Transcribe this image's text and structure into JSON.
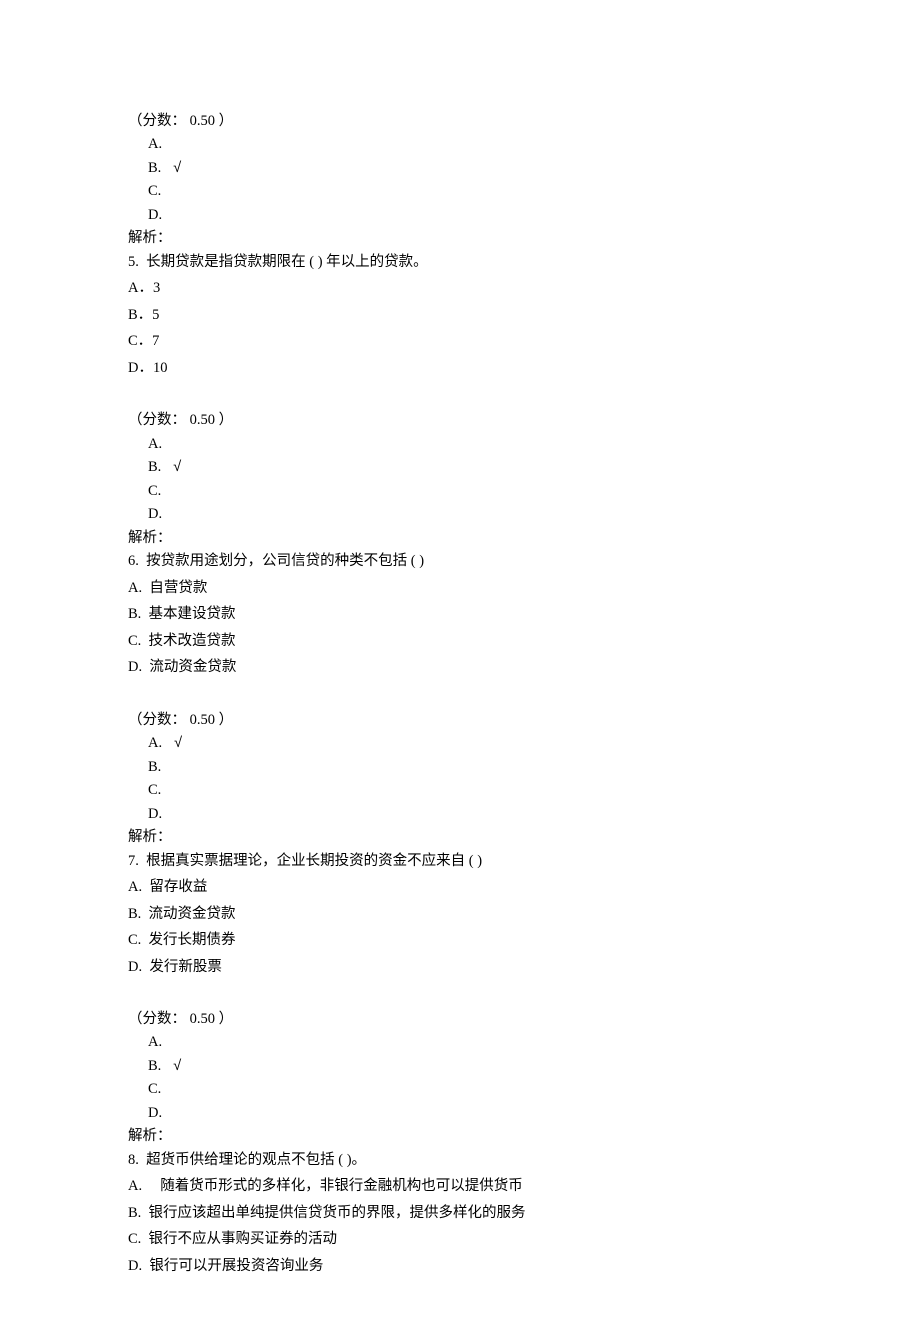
{
  "q4": {
    "score_label": "（分数： 0.50 ）",
    "ansA": "A.",
    "ansB": "B.",
    "ansB_mark": "√",
    "ansC": "C.",
    "ansD": "D.",
    "analysis": "解析："
  },
  "q5": {
    "stem": "5.  长期贷款是指贷款期限在 ( ) 年以上的贷款。",
    "optA": "A．3",
    "optB": "B．5",
    "optC": "C．7",
    "optD": "D．10",
    "score_label": "（分数： 0.50 ）",
    "ansA": "A.",
    "ansB": "B.",
    "ansB_mark": "√",
    "ansC": "C.",
    "ansD": "D.",
    "analysis": "解析："
  },
  "q6": {
    "stem": "6.  按贷款用途划分，公司信贷的种类不包括 ( )",
    "optA": "A.  自营贷款",
    "optB": "B.  基本建设贷款",
    "optC": "C.  技术改造贷款",
    "optD": "D.  流动资金贷款",
    "score_label": "（分数： 0.50 ）",
    "ansA": "A.",
    "ansA_mark": "√",
    "ansB": "B.",
    "ansC": "C.",
    "ansD": "D.",
    "analysis": "解析："
  },
  "q7": {
    "stem": "7.  根据真实票据理论，企业长期投资的资金不应来自 ( )",
    "optA": "A.  留存收益",
    "optB": "B.  流动资金贷款",
    "optC": "C.  发行长期债券",
    "optD": "D.  发行新股票",
    "score_label": "（分数： 0.50 ）",
    "ansA": "A.",
    "ansB": "B.",
    "ansB_mark": "√",
    "ansC": "C.",
    "ansD": "D.",
    "analysis": "解析："
  },
  "q8": {
    "stem": "8.  超货币供给理论的观点不包括 ( )。",
    "optA": "A.     随着货币形式的多样化，非银行金融机构也可以提供货币",
    "optB": "B.  银行应该超出单纯提供信贷货币的界限，提供多样化的服务",
    "optC": "C.  银行不应从事购买证券的活动",
    "optD": "D.  银行可以开展投资咨询业务"
  }
}
